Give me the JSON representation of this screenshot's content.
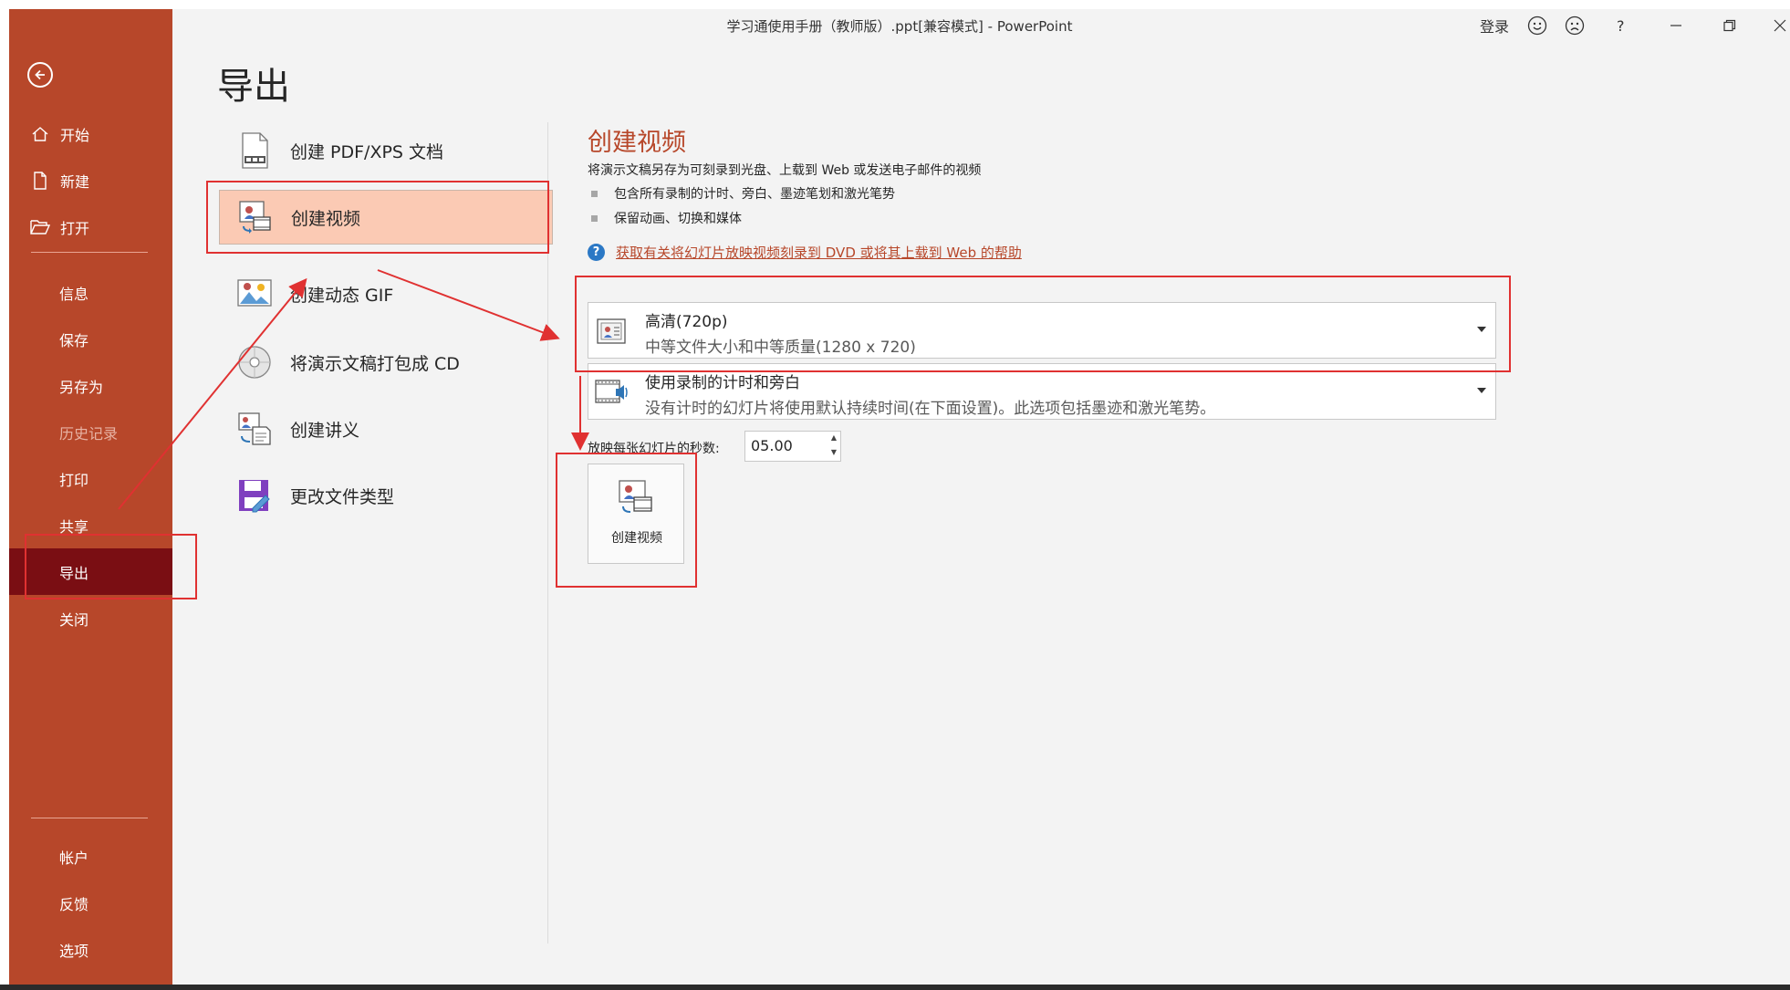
{
  "window": {
    "title": "学习通使用手册（教师版）.ppt[兼容模式]  -  PowerPoint",
    "sign_in": "登录",
    "controls": [
      "smile-icon",
      "frown-icon",
      "help-icon",
      "minimize-icon",
      "restore-icon",
      "close-icon"
    ],
    "help_glyph": "?"
  },
  "sidebar": {
    "items": [
      {
        "label": "开始",
        "icon": "home-icon"
      },
      {
        "label": "新建",
        "icon": "new-document-icon"
      },
      {
        "label": "打开",
        "icon": "open-folder-icon"
      },
      {
        "label": "信息"
      },
      {
        "label": "保存"
      },
      {
        "label": "另存为"
      },
      {
        "label": "历史记录",
        "state": "disabled"
      },
      {
        "label": "打印"
      },
      {
        "label": "共享"
      },
      {
        "label": "导出",
        "state": "active"
      },
      {
        "label": "关闭"
      },
      {
        "label": "帐户"
      },
      {
        "label": "反馈"
      },
      {
        "label": "选项"
      }
    ]
  },
  "page": {
    "title": "导出"
  },
  "export_options": [
    {
      "label": "创建 PDF/XPS 文档",
      "icon": "pdf-document-icon"
    },
    {
      "label": "创建视频",
      "icon": "video-icon",
      "selected": true
    },
    {
      "label": "创建动态 GIF",
      "icon": "gif-image-icon"
    },
    {
      "label": "将演示文稿打包成 CD",
      "icon": "cd-icon"
    },
    {
      "label": "创建讲义",
      "icon": "handout-icon"
    },
    {
      "label": "更改文件类型",
      "icon": "save-as-type-icon"
    }
  ],
  "detail": {
    "title": "创建视频",
    "description": "将演示文稿另存为可刻录到光盘、上载到 Web 或发送电子邮件的视频",
    "bullets": [
      "包含所有录制的计时、旁白、墨迹笔划和激光笔势",
      "保留动画、切换和媒体"
    ],
    "help_link": "获取有关将幻灯片放映视频刻录到 DVD 或将其上载到 Web 的帮助",
    "quality": {
      "main": "高清(720p)",
      "sub": "中等文件大小和中等质量(1280 x 720)"
    },
    "timing": {
      "main": "使用录制的计时和旁白",
      "sub": "没有计时的幻灯片将使用默认持续时间(在下面设置)。此选项包括墨迹和激光笔势。"
    },
    "seconds_label": "放映每张幻灯片的秒数:",
    "seconds_value": "05.00",
    "create_button": "创建视频"
  },
  "colors": {
    "accent": "#b7472a",
    "sidebar_active": "#7a0e13",
    "selected_option": "#fbcab4",
    "annotation": "#e03131"
  }
}
